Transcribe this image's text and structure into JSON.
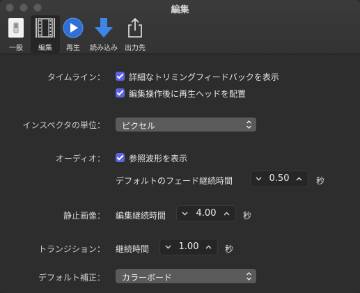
{
  "window": {
    "title": "編集"
  },
  "toolbar": {
    "items": [
      {
        "label": "一般",
        "icon": "general-switch-icon",
        "selected": false
      },
      {
        "label": "編集",
        "icon": "film-strip-icon",
        "selected": true
      },
      {
        "label": "再生",
        "icon": "play-icon",
        "selected": false
      },
      {
        "label": "読み込み",
        "icon": "download-arrow-icon",
        "selected": false
      },
      {
        "label": "出力先",
        "icon": "share-icon",
        "selected": false
      }
    ]
  },
  "timeline": {
    "label": "タイムライン：",
    "option1": {
      "text": "詳細なトリミングフィードバックを表示",
      "checked": true
    },
    "option2": {
      "text": "編集操作後に再生ヘッドを配置",
      "checked": true
    }
  },
  "inspector": {
    "label": "インスペクタの単位：",
    "value": "ピクセル"
  },
  "audio": {
    "label": "オーディオ：",
    "option": {
      "text": "参照波形を表示",
      "checked": true
    },
    "fade_label": "デフォルトのフェード継続時間",
    "fade_value": "0.50",
    "fade_unit": "秒"
  },
  "still": {
    "label": "静止画像：",
    "duration_label": "編集継続時間",
    "value": "4.00",
    "unit": "秒"
  },
  "transition": {
    "label": "トランジション：",
    "duration_label": "継続時間",
    "value": "1.00",
    "unit": "秒"
  },
  "correction": {
    "label": "デフォルト補正：",
    "value": "カラーボード"
  },
  "colors": {
    "accent": "#5c63e8",
    "background": "#2d2d2d",
    "control": "#5a5a5a",
    "field": "#262626"
  }
}
